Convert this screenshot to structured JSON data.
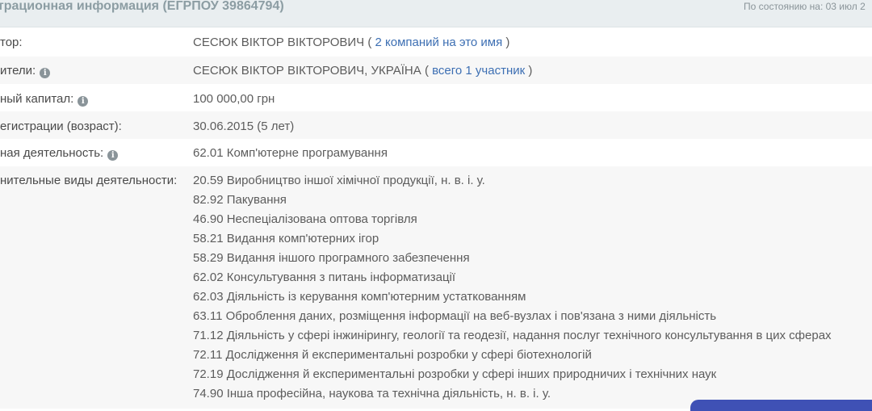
{
  "header": {
    "title": "страционная информация (ЕГРПОУ 39864794)",
    "status": "По состоянию на: 03 июл 2"
  },
  "rows": {
    "director": {
      "label": "тор:",
      "value": "СЕСЮК ВІКТОР ВІКТОРОВИЧ",
      "open_paren": " ( ",
      "link": "2 компаний на это имя",
      "close_paren": " )"
    },
    "founders": {
      "label": "ители:",
      "value": "СЕСЮК ВІКТОР ВІКТОРОВИЧ, УКРАЇНА",
      "open_paren": " ( ",
      "link": "всего 1 участник",
      "close_paren": " )"
    },
    "capital": {
      "label": "ный капитал:",
      "value": "100 000,00 грн"
    },
    "registration": {
      "label": "егистрации (возраст):",
      "value": "30.06.2015 (5 лет)"
    },
    "main_activity": {
      "label": "ная деятельность:",
      "value": "62.01 Комп'ютерне програмування"
    },
    "additional": {
      "label": "нительные виды деятельности:"
    }
  },
  "additional_activities": [
    "20.59 Виробництво іншої хімічної продукції, н. в. і. у.",
    "82.92 Пакування",
    "46.90 Неспеціалізована оптова торгівля",
    "58.21 Видання комп'ютерних ігор",
    "58.29 Видання іншого програмного забезпечення",
    "62.02 Консультування з питань інформатизації",
    "62.03 Діяльність із керування комп'ютерним устаткованням",
    "63.11 Оброблення даних, розміщення інформації на веб-вузлах і пов'язана з ними діяльність",
    "71.12 Діяльність у сфері інжинірингу, геології та геодезії, надання послуг технічного консультування в цих сферах",
    "72.11 Дослідження й експериментальні розробки у сфері біотехнологій",
    "72.19 Дослідження й експериментальні розробки у сфері інших природничих і технічних наук",
    "74.90 Інша професійна, наукова та технічна діяльність, н. в. і. у."
  ],
  "icons": {
    "info": "i"
  },
  "colors": {
    "link": "#3d6fb3",
    "header_bg": "#e9eef0",
    "accent": "#3f51b5"
  }
}
